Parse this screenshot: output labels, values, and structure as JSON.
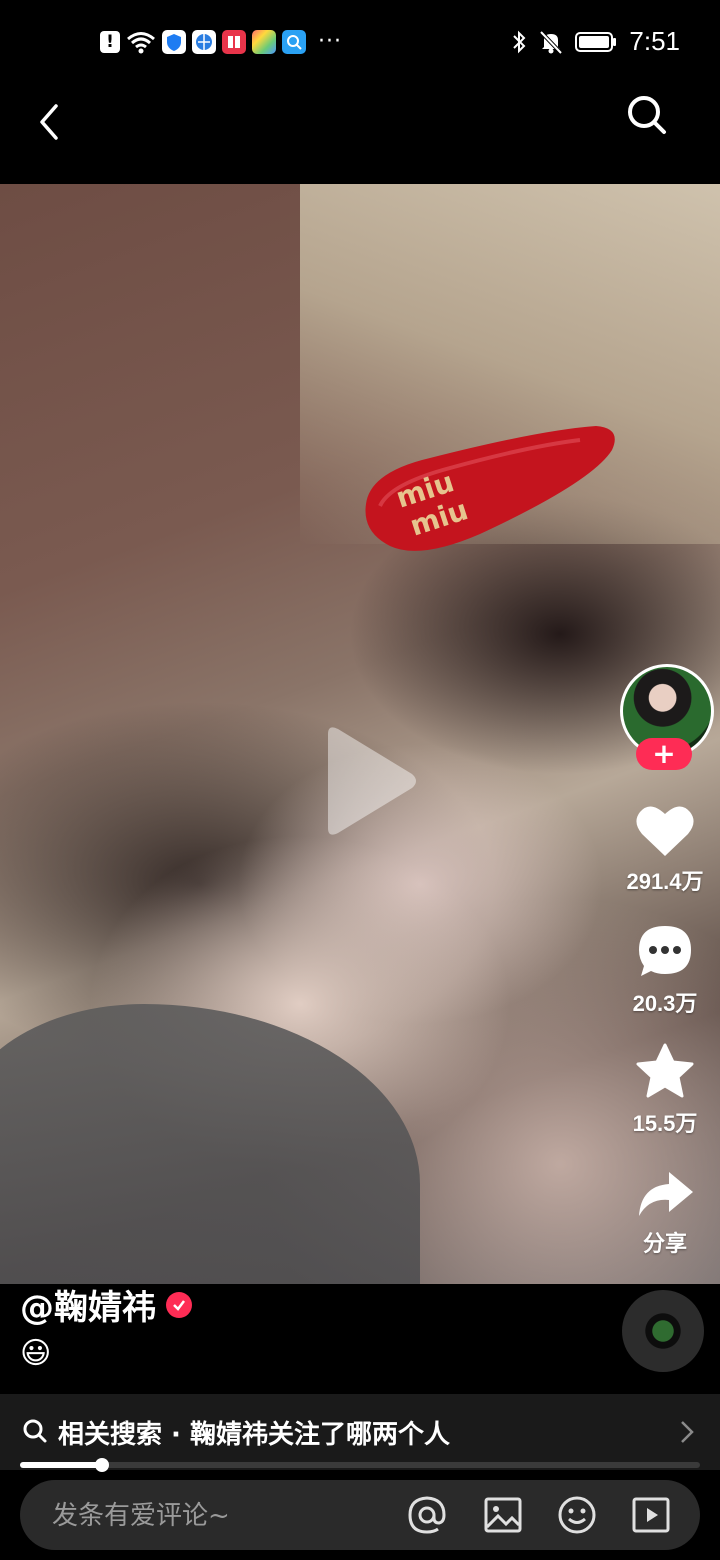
{
  "status_bar": {
    "time": "7:51",
    "icons": [
      "warning-icon",
      "wifi-icon",
      "shield-app-icon",
      "browser-app-icon",
      "book-app-icon",
      "photos-app-icon",
      "search-app-icon",
      "more-dots",
      "bluetooth-icon",
      "mute-bell-icon",
      "battery-icon"
    ],
    "more": "···"
  },
  "nav": {
    "back_icon": "chevron-left-icon",
    "search_icon": "search-icon"
  },
  "video": {
    "state": "paused",
    "play_icon": "play-icon"
  },
  "sidebar": {
    "follow_label": "+",
    "likes": "291.4万",
    "comments": "20.3万",
    "favorites": "15.5万",
    "share_label": "分享"
  },
  "post": {
    "author": "@鞠婧祎",
    "verified": true,
    "caption": "😃"
  },
  "related": {
    "label": "相关搜索 · 鞠婧祎关注了哪两个人"
  },
  "progress": {
    "fraction": 0.12
  },
  "comment_bar": {
    "placeholder": "发条有爱评论~",
    "icons": [
      "at-icon",
      "image-icon",
      "emoji-icon",
      "video-icon"
    ]
  },
  "colors": {
    "accent": "#fe2c55",
    "background": "#000000",
    "input_bg": "#2a2a2a",
    "related_bg": "#1a1a1a"
  }
}
